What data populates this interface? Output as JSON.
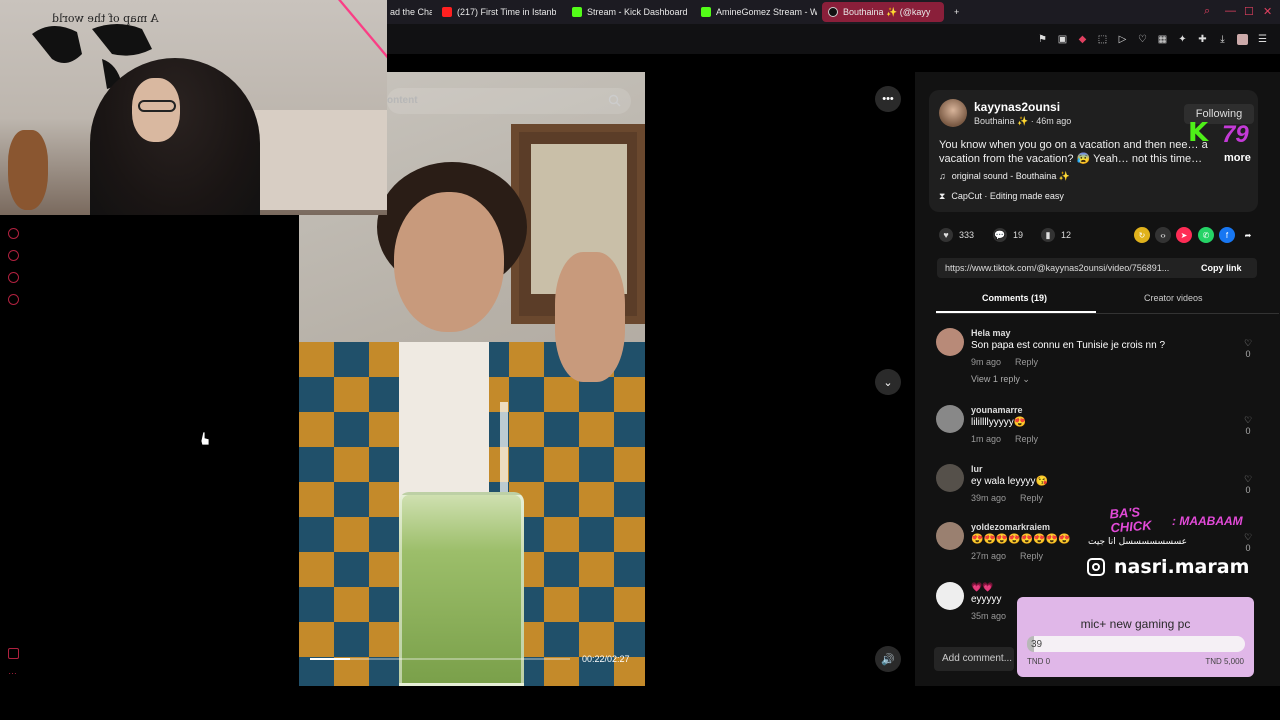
{
  "browser": {
    "tabs": [
      {
        "label": "ad the Cha",
        "icon": "none"
      },
      {
        "label": "(217) First Time in Istanbu",
        "icon": "youtube"
      },
      {
        "label": "Stream - Kick Dashboard",
        "icon": "kick"
      },
      {
        "label": "AmineGomez Stream - W",
        "icon": "kick"
      },
      {
        "label": "Bouthaina ✨ (@kayy",
        "icon": "tiktok",
        "active": true
      }
    ],
    "new_tab": "+"
  },
  "webcam": {
    "map_title": "A map of the world"
  },
  "video": {
    "search_placeholder": "ontent",
    "time": "00:22/02:27",
    "progress": 0.155
  },
  "post": {
    "username": "kayynas2ounsi",
    "display_sub": "Bouthaina ✨ · 46m ago",
    "follow_label": "Following",
    "caption": "You know when you go on a vacation and then nee… a vacation from the vacation? 😰 Yeah… not this time…",
    "more_label": "more",
    "sound": "original sound - Bouthaina ✨",
    "capcut": "CapCut · Editing made easy",
    "likes": "333",
    "comments_count": "19",
    "saves": "12",
    "link": "https://www.tiktok.com/@kayynas2ounsi/video/756891...",
    "copy_label": "Copy link"
  },
  "tabs": {
    "comments": "Comments (19)",
    "creator": "Creator videos"
  },
  "comments": [
    {
      "user": "Hela may",
      "text": "Son papa est connu en Tunisie je crois nn ?",
      "time": "9m ago",
      "reply": "Reply",
      "likes": "0",
      "replies": "View 1 reply ⌄"
    },
    {
      "user": "younamarre",
      "text": "lilillllyyyyy😍",
      "time": "1m ago",
      "reply": "Reply",
      "likes": "0"
    },
    {
      "user": "lur",
      "text": "ey wala leyyyy😘",
      "time": "39m ago",
      "reply": "Reply",
      "likes": "0"
    },
    {
      "user": "yoldezomarkraiem",
      "text": "😍😍😍😍😍😍😍😍",
      "time": "27m ago",
      "reply": "Reply",
      "likes": "0"
    },
    {
      "user": "💗💗",
      "text": "eyyyyy",
      "time": "35m ago",
      "reply": "",
      "likes": ""
    }
  ],
  "comment_input": {
    "placeholder": "Add comment..."
  },
  "overlays": {
    "kick_letter": "K",
    "kick_viewers": "79",
    "badge_line1": "BA'S",
    "badge_line2": "CHICK",
    "badge_name": ": MAABAAM",
    "arabic": "عسسسسسسسل انا جيت",
    "instagram": "nasri.maram"
  },
  "goal": {
    "title": "mic+ new gaming pc",
    "current": "39",
    "min_label": "TND 0",
    "max_label": "TND 5,000",
    "fraction": 0.0078
  },
  "colors": {
    "accent": "#8a1f3a",
    "kick_green": "#53fc18",
    "goal_bg": "#e0b7e8"
  }
}
